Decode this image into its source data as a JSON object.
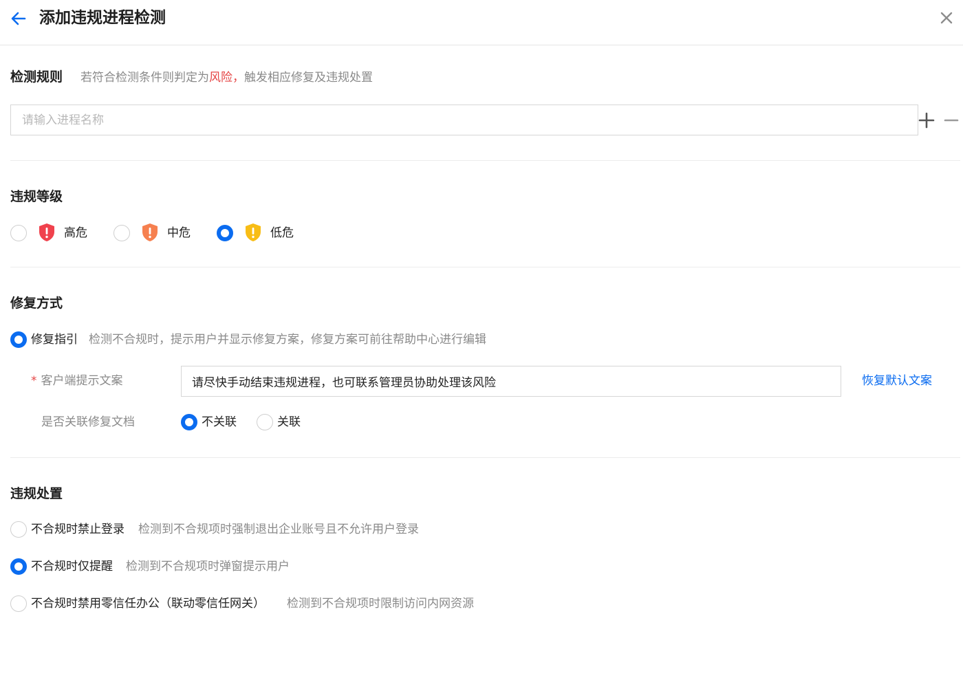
{
  "header": {
    "title": "添加违规进程检测",
    "back_icon": "arrow-left-icon",
    "close_icon": "close-icon"
  },
  "detect_rule": {
    "title": "检测规则",
    "desc_prefix": "若符合检测条件则判定为",
    "desc_risk": "风险，",
    "desc_suffix": "触发相应修复及违规处置",
    "input_placeholder": "请输入进程名称",
    "input_value": "",
    "add_icon": "plus-icon",
    "remove_icon": "minus-icon"
  },
  "violation_level": {
    "title": "违规等级",
    "options": [
      {
        "label": "高危",
        "checked": false,
        "color": "#f0424d",
        "icon": "shield-alert-icon"
      },
      {
        "label": "中危",
        "checked": false,
        "color": "#f6804f",
        "icon": "shield-alert-icon"
      },
      {
        "label": "低危",
        "checked": true,
        "color": "#f8bd16",
        "icon": "shield-alert-icon"
      }
    ]
  },
  "repair": {
    "title": "修复方式",
    "option_label": "修复指引",
    "option_desc": "检测不合规时，提示用户并显示修复方案，修复方案可前往帮助中心进行编辑",
    "option_checked": true,
    "hint_label": "客户端提示文案",
    "hint_required_mark": "*",
    "hint_value": "请尽快手动结束违规进程，也可联系管理员协助处理该风险",
    "restore_link": "恢复默认文案",
    "doc_label": "是否关联修复文档",
    "doc_options": [
      {
        "label": "不关联",
        "checked": true
      },
      {
        "label": "关联",
        "checked": false
      }
    ]
  },
  "disposal": {
    "title": "违规处置",
    "options": [
      {
        "label": "不合规时禁止登录",
        "desc": "检测到不合规项时强制退出企业账号且不允许用户登录",
        "checked": false
      },
      {
        "label": "不合规时仅提醒",
        "desc": "检测到不合规项时弹窗提示用户",
        "checked": true
      },
      {
        "label": "不合规时禁用零信任办公（联动零信任网关）",
        "desc": "检测到不合规项时限制访问内网资源",
        "checked": false
      }
    ]
  },
  "colors": {
    "accent": "#0b6cf0",
    "risk_text": "#e54545",
    "secondary_text": "#8a8a8a"
  }
}
